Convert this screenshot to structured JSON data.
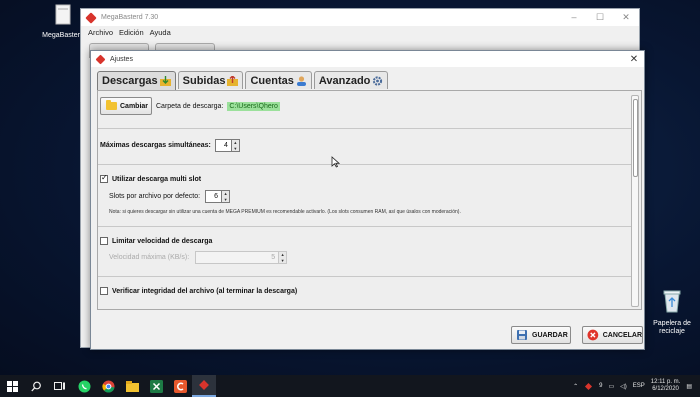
{
  "desktop": {
    "icon_top_label": "MegaBasterd",
    "recycle_bin_label_line1": "Papelera de",
    "recycle_bin_label_line2": "reciclaje"
  },
  "main_window": {
    "title": "MegaBasterd 7.30",
    "menu": [
      "Archivo",
      "Edición",
      "Ayuda"
    ]
  },
  "dialog": {
    "title": "Ajustes",
    "tabs": [
      {
        "label": "Descargas",
        "icon": "download-arrow-icon",
        "active": true
      },
      {
        "label": "Subidas",
        "icon": "upload-arrow-icon",
        "active": false
      },
      {
        "label": "Cuentas",
        "icon": "user-icon",
        "active": false
      },
      {
        "label": "Avanzado",
        "icon": "gear-icon",
        "active": false
      }
    ],
    "change_button": "Cambiar",
    "download_folder_label": "Carpeta de descarga:",
    "download_folder_path": "C:\\Users\\Qhero",
    "max_downloads_label": "Máximas descargas simultáneas:",
    "max_downloads_value": "4",
    "multi_slot_label": "Utilizar descarga multi slot",
    "multi_slot_checked": true,
    "slots_label": "Slots por archivo por defecto:",
    "slots_value": "6",
    "note": "Nota: si quieres descargar sin utilizar una cuenta de MEGA PREMIUM es recomendable activarlo. (Los slots consumen RAM, así que úsalos con moderación).",
    "limit_speed_label": "Limitar velocidad de descarga",
    "limit_speed_checked": false,
    "max_speed_label": "Velocidad máxima (KB/s):",
    "max_speed_value": "5",
    "verify_label": "Verificar integridad del archivo (al terminar la descarga)",
    "verify_checked": false,
    "save_button": "GUARDAR",
    "cancel_button": "CANCELAR"
  },
  "taskbar": {
    "time": "12:11 p. m.",
    "date": "6/12/2020",
    "language": "ESP",
    "badge": "9"
  },
  "colors": {
    "path_highlight": "#9be09b",
    "app_red": "#d8342c"
  }
}
